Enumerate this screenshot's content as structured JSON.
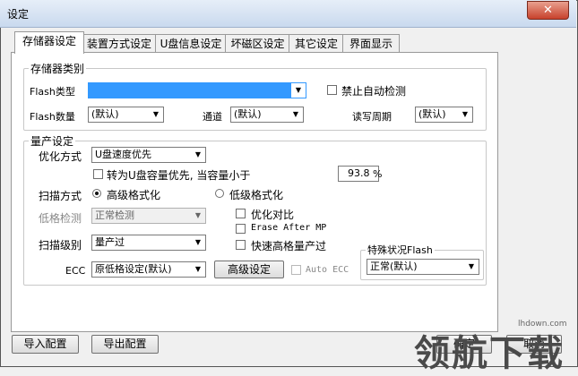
{
  "window": {
    "title": "设定",
    "close_glyph": "✕"
  },
  "tabs": [
    "存储器设定",
    "装置方式设定",
    "U盘信息设定",
    "坏磁区设定",
    "其它设定",
    "界面显示"
  ],
  "storage_type": {
    "legend": "存储器类别",
    "flash_type_label": "Flash类型",
    "flash_type_value": "",
    "disable_autodetect_label": "禁止自动检测",
    "flash_count_label": "Flash数量",
    "flash_count_value": "(默认)",
    "channel_label": "通道",
    "channel_value": "(默认)",
    "rw_cycle_label": "读写周期",
    "rw_cycle_value": "(默认)"
  },
  "production": {
    "legend": "量产设定",
    "optimize_label": "优化方式",
    "optimize_value": "U盘速度优先",
    "convert_label": "转为U盘容量优先, 当容量小于",
    "convert_value": "93.8",
    "convert_unit": "%",
    "scan_mode_label": "扫描方式",
    "scan_high": "高级格式化",
    "scan_low": "低级格式化",
    "low_check_label": "低格检测",
    "low_check_value": "正常检测",
    "optimize_compare": "优化对比",
    "erase_after_mp": "Erase After MP",
    "fast_high_format": "快速高格量产过",
    "scan_level_label": "扫描级别",
    "scan_level_value": "量产过",
    "special_legend": "特殊状况Flash",
    "special_value": "正常(默认)",
    "ecc_label": "ECC",
    "ecc_value": "原低格设定(默认)",
    "advanced_button": "高级设定",
    "auto_ecc": "Auto ECC"
  },
  "footer": {
    "import": "导入配置",
    "export": "导出配置",
    "ok": "确定",
    "cancel": "取消"
  },
  "watermark": {
    "text": "领航下载",
    "url": "lhdown.com"
  }
}
